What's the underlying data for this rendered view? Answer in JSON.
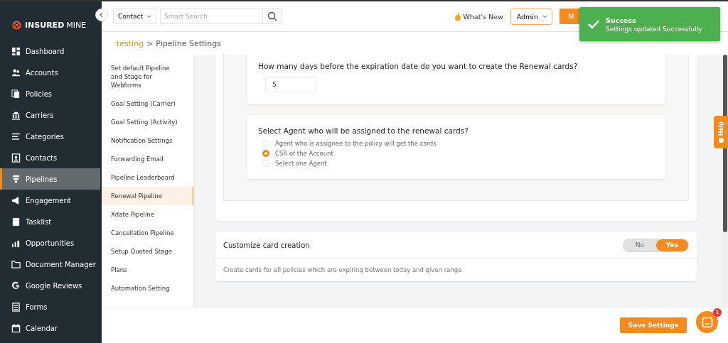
{
  "sidebar": {
    "logo": {
      "bold": "INSURED",
      "light": "MINE"
    },
    "items": [
      {
        "label": "Dashboard",
        "selected": false
      },
      {
        "label": "Accounts",
        "selected": false
      },
      {
        "label": "Policies",
        "selected": false
      },
      {
        "label": "Carriers",
        "selected": false
      },
      {
        "label": "Categories",
        "selected": false
      },
      {
        "label": "Contacts",
        "selected": false
      },
      {
        "label": "Pipelines",
        "selected": true
      },
      {
        "label": "Engagement",
        "selected": false
      },
      {
        "label": "Tasklist",
        "selected": false
      },
      {
        "label": "Opportunities",
        "selected": false
      },
      {
        "label": "Document Manager",
        "selected": false
      },
      {
        "label": "Google Reviews",
        "selected": false
      },
      {
        "label": "Forms",
        "selected": false
      },
      {
        "label": "Calendar",
        "selected": false
      }
    ]
  },
  "topbar": {
    "search_scope": "Contact",
    "search": {
      "placeholder": "Smart Search"
    },
    "whats_new": "What's New",
    "role": "Admin",
    "orange_button": "M"
  },
  "toast": {
    "title": "Success",
    "message": "Settings updated Successfully"
  },
  "breadcrumb": {
    "parent": "testing",
    "separator": ">",
    "current": "Pipeline Settings"
  },
  "settings_menu": [
    {
      "label": "Set default Pipeline and Stage for Webforms",
      "selected": false
    },
    {
      "label": "Goal Setting (Carrier)",
      "selected": false
    },
    {
      "label": "Goal Setting (Activity)",
      "selected": false
    },
    {
      "label": "Notification Settings",
      "selected": false
    },
    {
      "label": "Forwarding Email",
      "selected": false
    },
    {
      "label": "Pipeline Leaderboard",
      "selected": false
    },
    {
      "label": "Renewal Pipeline",
      "selected": true
    },
    {
      "label": "Xdate Pipeline",
      "selected": false
    },
    {
      "label": "Cancellation Pipeline",
      "selected": false
    },
    {
      "label": "Setup Quoted Stage",
      "selected": false
    },
    {
      "label": "Plans",
      "selected": false
    },
    {
      "label": "Automation Setting",
      "selected": false
    }
  ],
  "days_question": {
    "label": "How many days before the expiration date do you want to create the Renewal cards?",
    "value": "5"
  },
  "agent_question": {
    "label": "Select Agent who will be assigned to the renewal cards?",
    "options": [
      {
        "label": "Agent who is assignee to the policy will get the cards",
        "selected": false
      },
      {
        "label": "CSR of the Account",
        "selected": true
      },
      {
        "label": "Select one Agent",
        "selected": false
      }
    ]
  },
  "customize": {
    "title": "Customize card creation",
    "options": [
      {
        "label": "No",
        "selected": false
      },
      {
        "label": "Yes",
        "selected": true
      }
    ],
    "description": "Create cards for all policies which are expiring between today and given range"
  },
  "help_tab": "Help",
  "save_button": "Save Settings",
  "chat_badge": "1"
}
